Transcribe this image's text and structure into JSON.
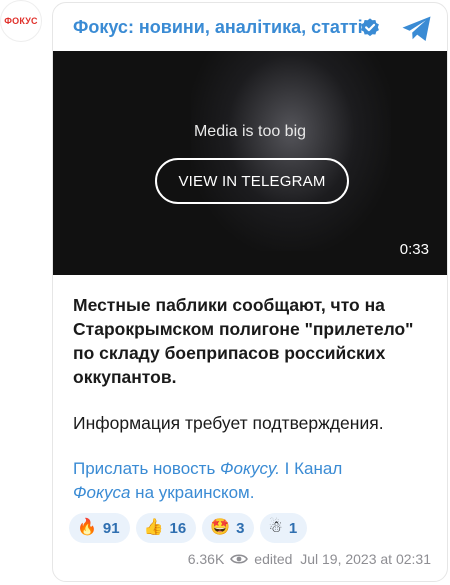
{
  "avatar": {
    "text": "ФОКУС"
  },
  "channel": {
    "title": "Фокус: новини, аналітика, статті"
  },
  "media": {
    "message": "Media is too big",
    "button_label": "VIEW IN TELEGRAM",
    "duration": "0:33"
  },
  "post": {
    "line1": "Местные паблики сообщают, что на",
    "line2": "Старокрымском полигоне \"прилетело\"",
    "line3": "по складу боеприпасов российских",
    "line4": "оккупантов.",
    "para2": "Информация требует подтверждения."
  },
  "links": {
    "send_news_pre": "Прислать новость ",
    "send_news_italic": "Фокусу",
    "send_news_post": ".",
    "separator": " I ",
    "channel_pre": "Канал ",
    "channel_italic": "Фокуса",
    "channel_post": " на украинском."
  },
  "reactions": [
    {
      "emoji": "🔥",
      "icon": "fire-icon",
      "count": "91"
    },
    {
      "emoji": "👍",
      "icon": "thumbs-up-icon",
      "count": "16"
    },
    {
      "emoji": "🤩",
      "icon": "star-struck-icon",
      "count": "3"
    },
    {
      "emoji": "☃",
      "icon": "snowman-icon",
      "count": "1"
    }
  ],
  "meta": {
    "views": "6.36K",
    "edited": "edited  Jul 19, 2023 at 02:31"
  },
  "colors": {
    "accent": "#3a8bd4",
    "brand_red": "#e0302a",
    "reaction_bg": "#eaf2fb",
    "media_bg": "#111111"
  }
}
